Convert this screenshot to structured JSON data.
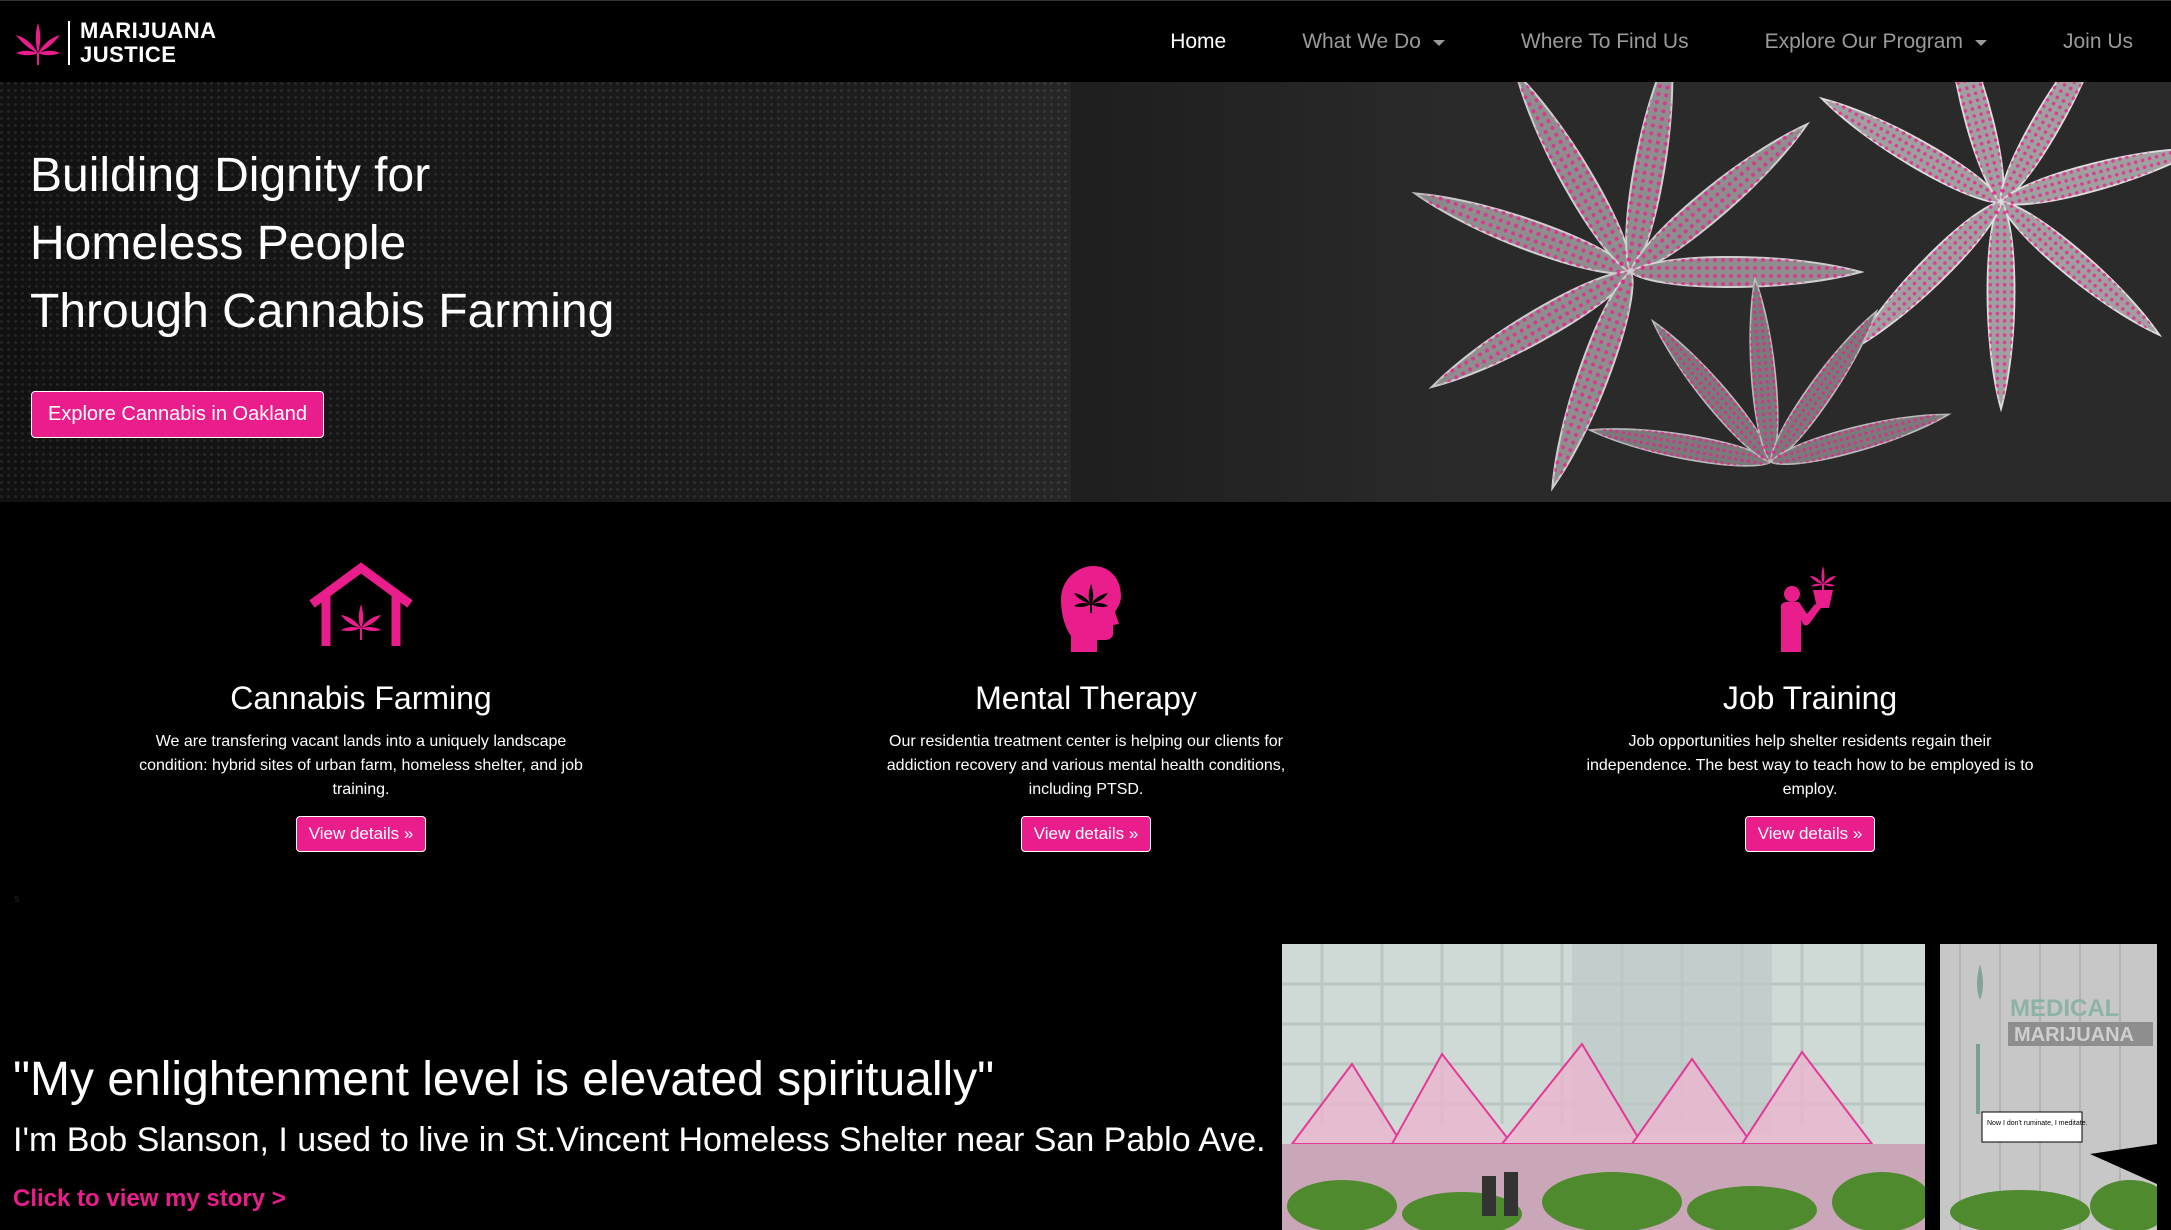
{
  "brand": {
    "line1": "MARIJUANA",
    "line2": "JUSTICE",
    "logo_icon": "cannabis-leaf-icon"
  },
  "nav": {
    "items": [
      {
        "label": "Home",
        "active": true,
        "dropdown": false
      },
      {
        "label": "What We Do",
        "active": false,
        "dropdown": true
      },
      {
        "label": "Where To Find Us",
        "active": false,
        "dropdown": false
      },
      {
        "label": "Explore Our Program",
        "active": false,
        "dropdown": true
      },
      {
        "label": "Join Us",
        "active": false,
        "dropdown": false
      }
    ]
  },
  "hero": {
    "title_lines": [
      "Building Dignity for",
      "Homeless People",
      "Through Cannabis Farming"
    ],
    "button": "Explore Cannabis in Oakland"
  },
  "features": [
    {
      "title": "Cannabis Farming",
      "icon": "house-cannabis-icon",
      "text": "We are transfering vacant lands into a uniquely landscape condition: hybrid sites of urban farm, homeless shelter, and job training.",
      "button": "View details »"
    },
    {
      "title": "Mental Therapy",
      "icon": "head-cannabis-icon",
      "text": "Our residentia treatment center is helping our clients for addiction recovery and various mental health conditions, including PTSD.",
      "button": "View details »"
    },
    {
      "title": "Job Training",
      "icon": "person-plant-icon",
      "text": "Job opportunities help shelter residents regain their independence. The best way to teach how to be employed is to employ.",
      "button": "View details »"
    }
  ],
  "stray_text": "s",
  "story": {
    "quote": "\"My enlightenment level is elevated spiritually\"",
    "line": "I'm Bob Slanson, I used to live in St.Vincent Homeless Shelter near San Pablo Ave.",
    "link": "Click to view my story >"
  },
  "photo2": {
    "sign_line1": "MEDICAL",
    "sign_line2": "MARIJUANA",
    "caption": "Now I don't ruminate, I meditate."
  },
  "colors": {
    "accent": "#e91e8c",
    "background": "#000000",
    "nav_inactive": "#9a9a9a"
  }
}
